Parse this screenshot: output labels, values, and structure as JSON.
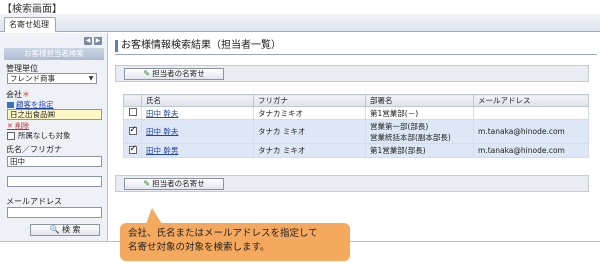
{
  "page_caption": "【検索画面】",
  "tab": {
    "label": "名寄せ処理"
  },
  "sidebar": {
    "title": "お客様担当者検索",
    "mgmt_unit_label": "管理単位",
    "mgmt_unit_value": "フレンド商事",
    "company_label": "会社",
    "customer_link": "顧客を指定",
    "company_value": "日之出食品㈱",
    "delete_link": "削除",
    "no_affiliation_label": "所属なしも対象",
    "name_label": "氏名／フリガナ",
    "name_value": "田中",
    "name_kana_value": "",
    "email_label": "メールアドレス",
    "email_value": "",
    "search_button": "検 索"
  },
  "main": {
    "title": "お客様情報検索結果（担当者一覧）",
    "assign_button": "担当者の名寄せ"
  },
  "table": {
    "headers": [
      "氏名",
      "フリガナ",
      "部署名",
      "メールアドレス"
    ],
    "rows": [
      {
        "checked": false,
        "name": "田中 幹夫",
        "kana": "タナカミキオ",
        "dept1": "第1営業部(－)",
        "dept2": "",
        "email": ""
      },
      {
        "checked": true,
        "name": "田中 幹夫",
        "kana": "タナカ ミキオ",
        "dept1": "営業第一部(部長)",
        "dept2": "営業統括本部(副本部長)",
        "email": "m.tanaka@hinode.com"
      },
      {
        "checked": true,
        "name": "田中 幹男",
        "kana": "タナカ ミキオ",
        "dept1": "第1営業部(部長)",
        "dept2": "",
        "email": "m.tanaka@hinode.com"
      }
    ]
  },
  "callout": {
    "line1": "会社、氏名またはメールアドレスを指定して",
    "line2": "名寄せ対象の対象を検索します。"
  }
}
